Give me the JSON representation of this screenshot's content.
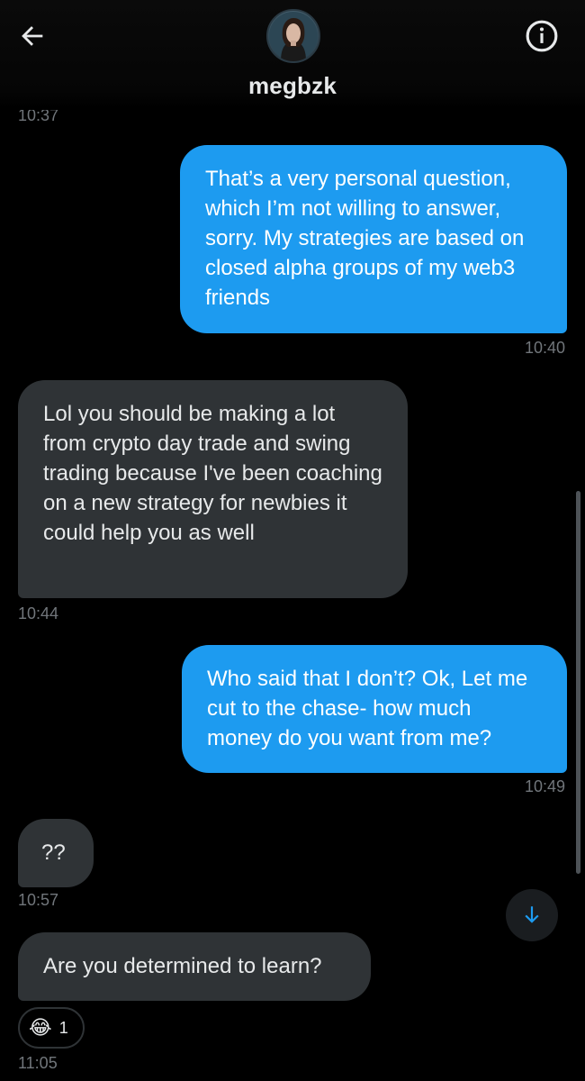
{
  "header": {
    "contact_name": "megbzk",
    "back_icon": "arrow-left-icon",
    "info_icon": "info-circle-icon"
  },
  "partial_timestamp": "10:37",
  "messages": [
    {
      "direction": "out",
      "text": "That’s a very personal question, which I’m not willing to answer, sorry. My strategies are based on closed alpha groups of my web3 friends",
      "time": "10:40"
    },
    {
      "direction": "in",
      "text": "Lol you should be making a lot from crypto day trade and swing trading because I've been coaching on a new strategy for newbies it could help you as well",
      "time": "10:44"
    },
    {
      "direction": "out",
      "text": "Who said that I don’t? Ok, Let me cut to the chase- how much money do you want from me?",
      "time": "10:49"
    },
    {
      "direction": "in",
      "text": "??",
      "time": "10:57"
    },
    {
      "direction": "in",
      "text": "Are you determined to learn?",
      "time": "11:05"
    }
  ],
  "reaction": {
    "emoji": "😂",
    "count": "1"
  },
  "colors": {
    "background": "#000000",
    "outgoing_bubble": "#1d9bf0",
    "incoming_bubble": "#2f3336",
    "timestamp": "#71767b",
    "accent": "#1d9bf0"
  }
}
